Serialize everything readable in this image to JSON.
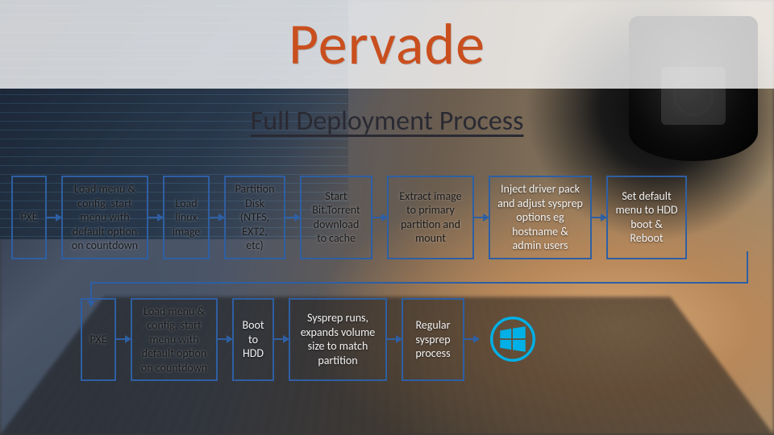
{
  "title": "Pervade",
  "subtitle": "Full Deployment Process",
  "row1": {
    "pxe": "PXE",
    "menu": "Load menu & config, start menu with default option on countdown",
    "load": "Load linux image",
    "partition": "Partition Disk (NTFS, EXT2, etc)",
    "bittorrent": "Start Bit.Torrent download to cache",
    "extract": "Extract image to primary partition and mount",
    "inject": "Inject driver pack and adjust sysprep options eg hostname & admin users",
    "setdefault": "Set default menu to HDD boot & Reboot"
  },
  "row2": {
    "pxe": "PXE",
    "menu": "Load menu & config, start menu with default option on countdown",
    "boot": "Boot to HDD",
    "sysprep": "Sysprep runs, expands volume size to match partition",
    "regular": "Regular sysprep process"
  },
  "icons": {
    "windows": "windows-logo"
  },
  "colors": {
    "accent": "#c94f1e",
    "box_border": "#2e5fa3",
    "logo": "#00b0e6"
  }
}
